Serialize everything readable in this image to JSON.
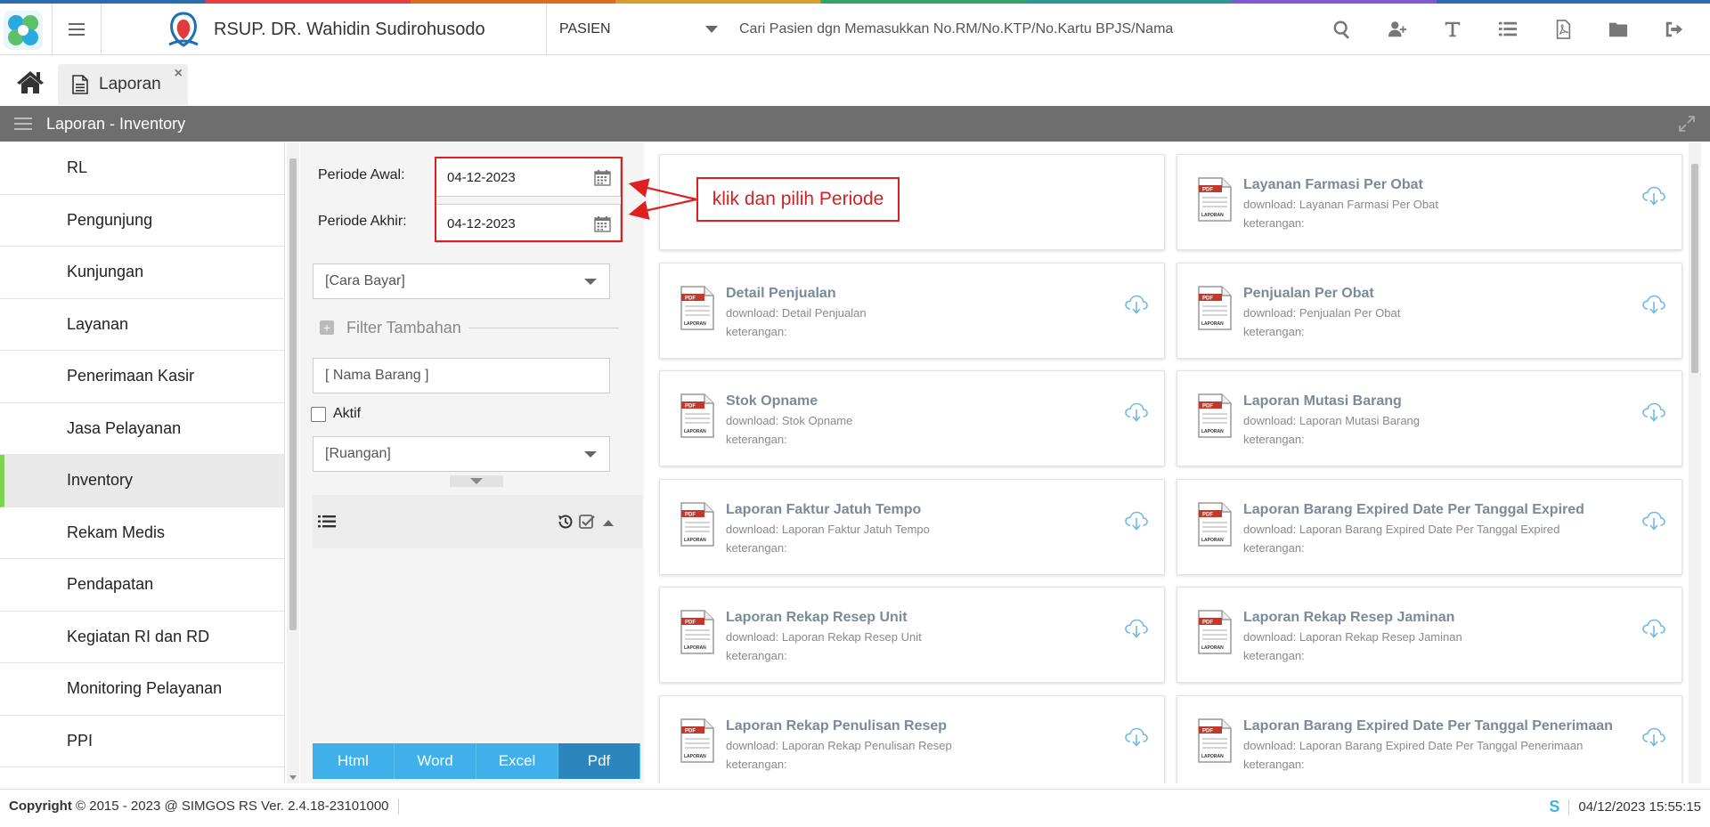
{
  "app": {
    "hospital_name": "RSUP. DR. Wahidin Sudirohusodo",
    "search_type": "PASIEN",
    "search_placeholder": "Cari Pasien dgn Memasukkan No.RM/No.KTP/No.Kartu BPJS/Nama",
    "top_icons": [
      "search-icon",
      "add-user-icon",
      "text-icon",
      "list-icon",
      "pdf-file-icon",
      "folder-icon",
      "logout-icon"
    ]
  },
  "tabs": [
    {
      "label": "Laporan",
      "close": "×"
    }
  ],
  "section": {
    "title": "Laporan - Inventory"
  },
  "sidebar": {
    "items": [
      {
        "label": "RL"
      },
      {
        "label": "Pengunjung"
      },
      {
        "label": "Kunjungan"
      },
      {
        "label": "Layanan"
      },
      {
        "label": "Penerimaan Kasir"
      },
      {
        "label": "Jasa Pelayanan"
      },
      {
        "label": "Inventory"
      },
      {
        "label": "Rekam Medis"
      },
      {
        "label": "Pendapatan"
      },
      {
        "label": "Kegiatan RI dan RD"
      },
      {
        "label": "Monitoring Pelayanan"
      },
      {
        "label": "PPI"
      }
    ],
    "active": "Inventory"
  },
  "filter": {
    "periode_awal_label": "Periode Awal:",
    "periode_awal_value": "04-12-2023",
    "periode_akhir_label": "Periode Akhir:",
    "periode_akhir_value": "04-12-2023",
    "cara_bayar": "[Cara Bayar]",
    "filter_tambahan": "Filter Tambahan",
    "nama_barang_placeholder": "[ Nama Barang ]",
    "aktif_label": "Aktif",
    "aktif_checked": false,
    "ruangan": "[Ruangan]",
    "export_buttons": [
      "Html",
      "Word",
      "Excel",
      "Pdf"
    ],
    "export_selected": "Pdf"
  },
  "annotation": {
    "text": "klik dan pilih Periode"
  },
  "reports": [
    {
      "title": "",
      "download": "",
      "keterangan": ""
    },
    {
      "title": "Layanan Farmasi Per Obat",
      "download": "download: Layanan Farmasi Per Obat",
      "keterangan": "keterangan:"
    },
    {
      "title": "Detail Penjualan",
      "download": "download: Detail Penjualan",
      "keterangan": "keterangan:"
    },
    {
      "title": "Penjualan Per Obat",
      "download": "download: Penjualan Per Obat",
      "keterangan": "keterangan:"
    },
    {
      "title": "Stok Opname",
      "download": "download: Stok Opname",
      "keterangan": "keterangan:"
    },
    {
      "title": "Laporan Mutasi Barang",
      "download": "download: Laporan Mutasi Barang",
      "keterangan": "keterangan:"
    },
    {
      "title": "Laporan Faktur Jatuh Tempo",
      "download": "download: Laporan Faktur Jatuh Tempo",
      "keterangan": "keterangan:"
    },
    {
      "title": "Laporan Barang Expired Date Per Tanggal Expired",
      "download": "download: Laporan Barang Expired Date Per Tanggal Expired",
      "keterangan": "keterangan:"
    },
    {
      "title": "Laporan Rekap Resep Unit",
      "download": "download: Laporan Rekap Resep Unit",
      "keterangan": "keterangan:"
    },
    {
      "title": "Laporan Rekap Resep Jaminan",
      "download": "download: Laporan Rekap Resep Jaminan",
      "keterangan": "keterangan:"
    },
    {
      "title": "Laporan Rekap Penulisan Resep",
      "download": "download: Laporan Rekap Penulisan Resep",
      "keterangan": "keterangan:"
    },
    {
      "title": "Laporan Barang Expired Date Per Tanggal Penerimaan",
      "download": "download: Laporan Barang Expired Date Per Tanggal Penerimaan",
      "keterangan": "keterangan:"
    }
  ],
  "doc_icon_label": "LAPORAN",
  "footer": {
    "copyright_label": "Copyright",
    "copyright_text": "2015 - 2023 @ SIMGOS RS Ver. 2.4.18-23101000",
    "logo": "S",
    "datetime": "04/12/2023 15:55:15"
  },
  "colors": {
    "accent": "#3fb0e9",
    "accent_dark": "#2a86bd",
    "active_marker": "#7bd34f",
    "annotation": "#e02020",
    "section_bar": "#6e6e6e"
  }
}
